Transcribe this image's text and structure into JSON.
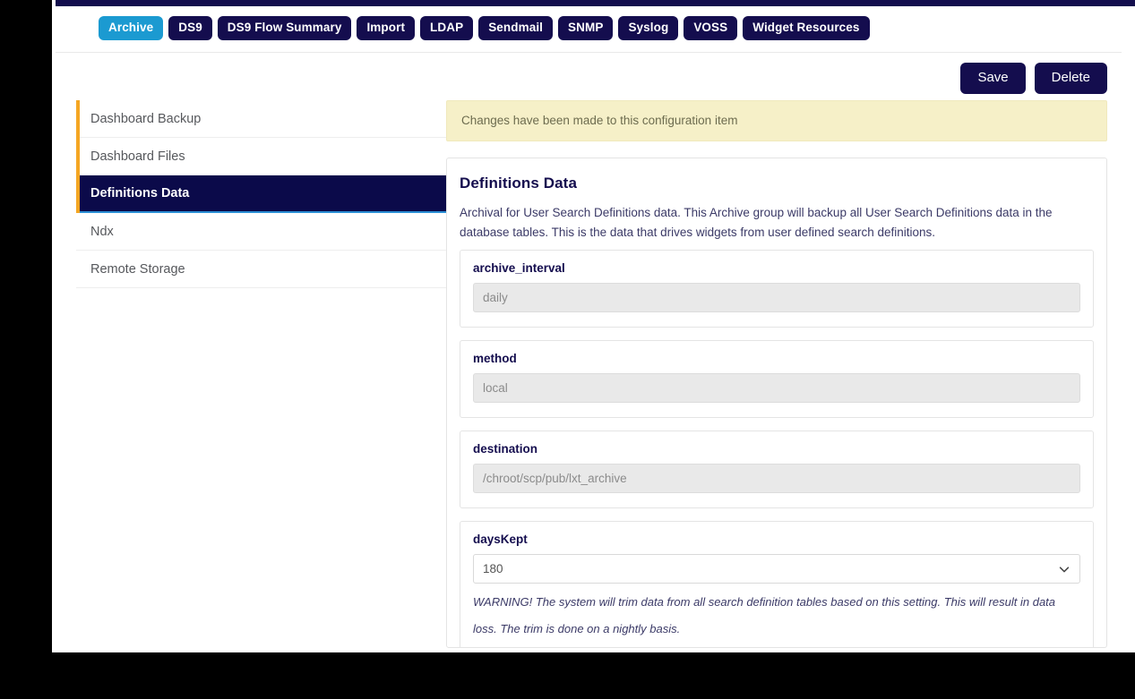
{
  "tabs": [
    {
      "label": "Archive",
      "active": true
    },
    {
      "label": "DS9",
      "active": false
    },
    {
      "label": "DS9 Flow Summary",
      "active": false
    },
    {
      "label": "Import",
      "active": false
    },
    {
      "label": "LDAP",
      "active": false
    },
    {
      "label": "Sendmail",
      "active": false
    },
    {
      "label": "SNMP",
      "active": false
    },
    {
      "label": "Syslog",
      "active": false
    },
    {
      "label": "VOSS",
      "active": false
    },
    {
      "label": "Widget Resources",
      "active": false
    }
  ],
  "actions": {
    "save_label": "Save",
    "delete_label": "Delete"
  },
  "sidebar": {
    "items": [
      {
        "label": "Dashboard Backup",
        "active": false,
        "accent": true
      },
      {
        "label": "Dashboard Files",
        "active": false,
        "accent": true
      },
      {
        "label": "Definitions Data",
        "active": true,
        "accent": true
      },
      {
        "label": "Ndx",
        "active": false,
        "accent": false
      },
      {
        "label": "Remote Storage",
        "active": false,
        "accent": false
      }
    ]
  },
  "alert": {
    "message": "Changes have been made to this configuration item"
  },
  "panel": {
    "title": "Definitions Data",
    "description": "Archival for User Search Definitions data. This Archive group will backup all User Search Definitions data in the database tables. This is the data that drives widgets from user defined search definitions."
  },
  "fields": [
    {
      "name": "archive_interval",
      "label": "archive_interval",
      "type": "text",
      "value": "daily",
      "disabled": true
    },
    {
      "name": "method",
      "label": "method",
      "type": "text",
      "value": "local",
      "disabled": true
    },
    {
      "name": "destination",
      "label": "destination",
      "type": "text",
      "value": "/chroot/scp/pub/lxt_archive",
      "disabled": true
    },
    {
      "name": "daysKept",
      "label": "daysKept",
      "type": "select",
      "value": "180",
      "options": [
        "180"
      ],
      "help": "WARNING! The system will trim data from all search definition tables based on this setting. This will result in data loss. The trim is done on a nightly basis."
    }
  ],
  "colors": {
    "navy": "#140d4e",
    "active_tab": "#1b9ad1",
    "accent_orange": "#f5a623",
    "alert_bg": "#f6f0c8",
    "active_item_bg": "#0b0a4a",
    "input_bg": "#e9e9e9"
  }
}
